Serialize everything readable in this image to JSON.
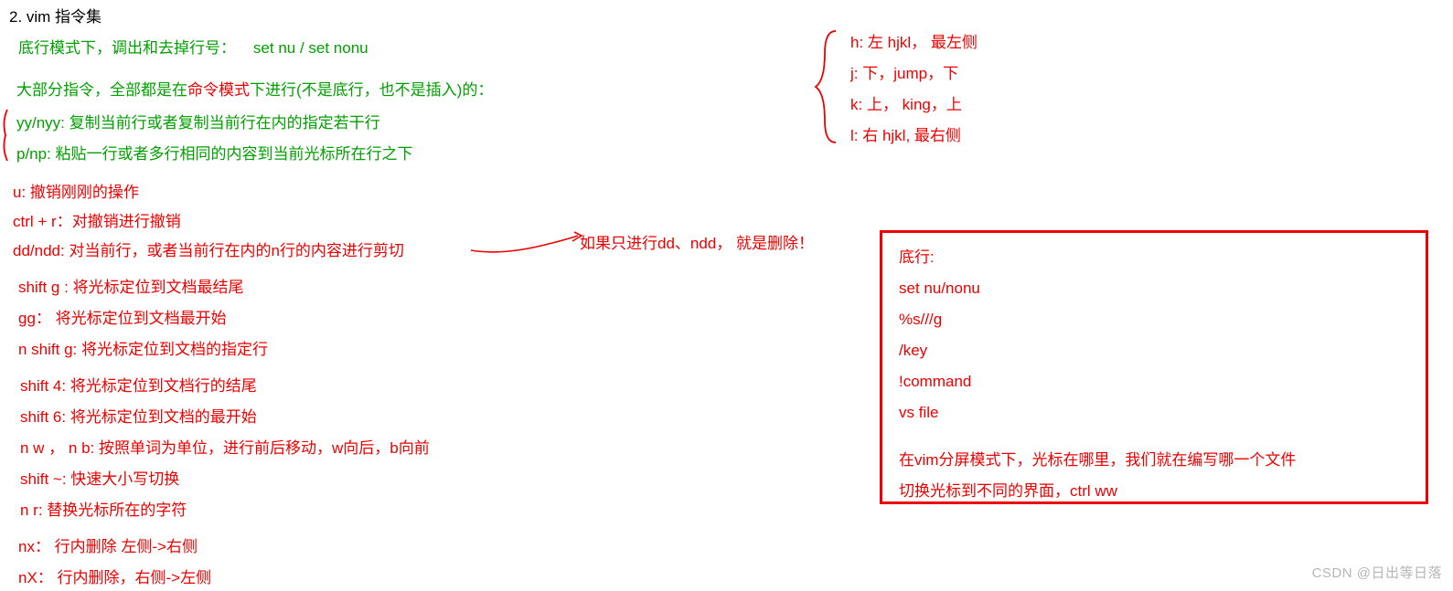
{
  "heading": "2. vim 指令集",
  "left": {
    "l1_a": "底行模式下，调出和去掉行号：",
    "l1_b": "set nu / set nonu",
    "l2_a": "大部分指令，全部都是在",
    "l2_b": "命令模式",
    "l2_c": "下进行(不是底行，也不是插入)的：",
    "l3": "yy/nyy: 复制当前行或者复制当前行在内的指定若干行",
    "l4": "p/np: 粘贴一行或者多行相同的内容到当前光标所在行之下",
    "l5": "u: 撤销刚刚的操作",
    "l6": "ctrl + r：对撤销进行撤销",
    "l7": "dd/ndd: 对当前行，或者当前行在内的n行的内容进行剪切",
    "l7_note": "如果只进行dd、ndd， 就是删除！",
    "l8": "shift g : 将光标定位到文档最结尾",
    "l9": "gg： 将光标定位到文档最开始",
    "l10": "n shift g: 将光标定位到文档的指定行",
    "l11": "shift 4: 将光标定位到文档行的结尾",
    "l12": "shift 6: 将光标定位到文档的最开始",
    "l13": "n w ， n b: 按照单词为单位，进行前后移动，w向后，b向前",
    "l14": "shift ~: 快速大小写切换",
    "l15": "n r: 替换光标所在的字符",
    "l16": "nx： 行内删除 左侧->右侧",
    "l17": "nX： 行内删除，右侧->左侧"
  },
  "right_list": {
    "r1": "h:  左  hjkl， 最左侧",
    "r2": "j:  下，jump，下",
    "r3": "k:  上， king，上",
    "r4": "l:  右  hjkl,  最右侧"
  },
  "box": {
    "b1": "底行:",
    "b2": "set nu/nonu",
    "b3": "%s///g",
    "b4": "/key",
    "b5": "!command",
    "b6": "vs file",
    "b7": "在vim分屏模式下，光标在哪里，我们就在编写哪一个文件",
    "b8": "切换光标到不同的界面，ctrl ww"
  },
  "watermark": "CSDN @日出等日落"
}
